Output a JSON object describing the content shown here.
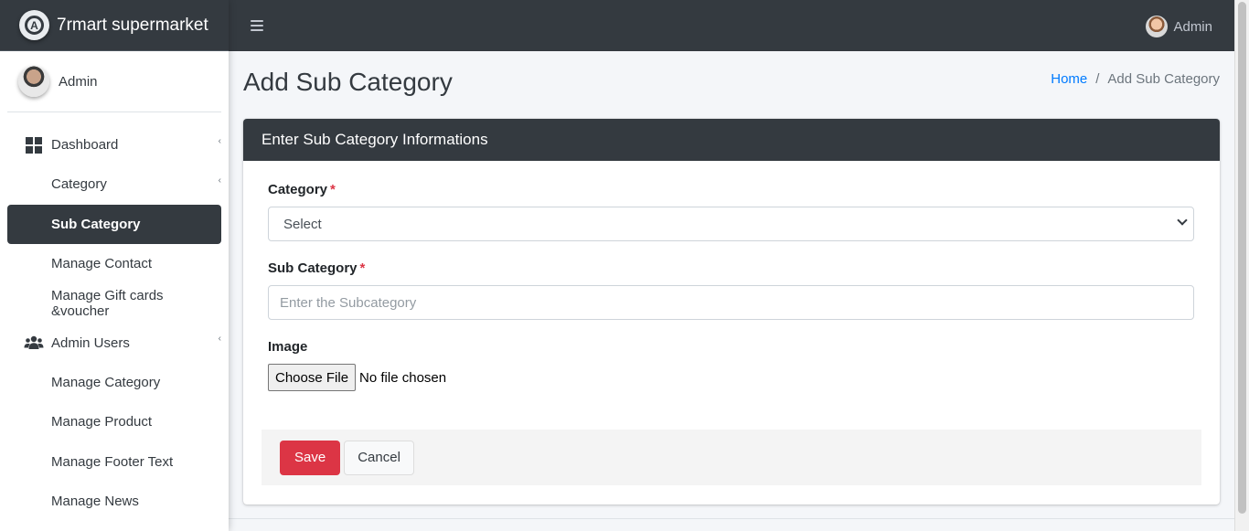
{
  "brand": {
    "name": "7rmart supermarket",
    "logo_letter": "A"
  },
  "sidebar": {
    "user_name": "Admin",
    "items": [
      {
        "label": "Dashboard",
        "icon": "grid-icon",
        "caret": "‹"
      },
      {
        "label": "Category",
        "caret": "‹"
      },
      {
        "label": "Sub Category",
        "active": true
      },
      {
        "label": "Manage Contact"
      },
      {
        "label": "Manage Gift cards &voucher"
      },
      {
        "label": "Admin Users",
        "icon": "users-icon",
        "caret": "‹"
      },
      {
        "label": "Manage Category"
      },
      {
        "label": "Manage Product"
      },
      {
        "label": "Manage Footer Text"
      },
      {
        "label": "Manage News"
      }
    ]
  },
  "topbar": {
    "user_name": "Admin"
  },
  "page": {
    "title": "Add Sub Category",
    "breadcrumb": {
      "home": "Home",
      "separator": "/",
      "current": "Add Sub Category"
    }
  },
  "form": {
    "header": "Enter Sub Category Informations",
    "category_label": "Category",
    "required_mark": "*",
    "category_select_value": "Select",
    "subcategory_label": "Sub Category",
    "subcategory_placeholder": "Enter the Subcategory",
    "image_label": "Image",
    "file_button": "Choose File",
    "file_status": "No file chosen",
    "save_label": "Save",
    "cancel_label": "Cancel"
  },
  "colors": {
    "dark": "#343a40",
    "active_bg": "#343a40",
    "link": "#007bff",
    "danger": "#dc3545",
    "page_bg": "#f4f6f9"
  }
}
